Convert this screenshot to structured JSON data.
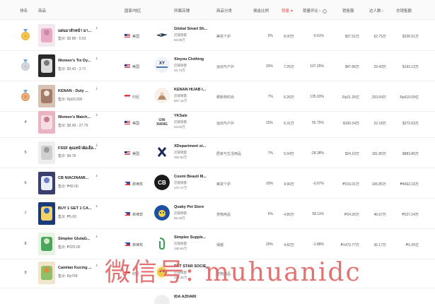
{
  "header": {
    "rank": "排名",
    "product": "商品",
    "region": "国家/地区",
    "shop": "所属店铺",
    "category": "商品分类",
    "commission": "佣金比例",
    "sales": "销量",
    "sales_growth": "销量环比",
    "gmv": "销售额",
    "creators": "达人数",
    "total_gmv": "总销售额"
  },
  "rows": [
    {
      "rank": "1",
      "medal": "gold",
      "name": "แผ่นมาส์กหน้า มา...",
      "price": "售价: $3.88 - 5.53",
      "flag": "us",
      "country": "美国",
      "shop_name": "Global Smart Sh...",
      "shop_sub": "店铺销量:",
      "shop_sales": "83.96万",
      "category": "美妆个护",
      "commission": "5%",
      "sales": "8.00万",
      "growth": "-9.61%",
      "gmv": "$37.51万",
      "creators": "62.75万",
      "total": "$236.51万"
    },
    {
      "rank": "2",
      "medal": "silver",
      "name": "Women's Tie Dy...",
      "price": "售价: $3.43 - 3.71",
      "flag": "us",
      "country": "美国",
      "shop_name": "Xinyou Clothing",
      "shop_sub": "店铺销量:",
      "shop_sales": "40.74万",
      "category": "运动与户外",
      "commission": "20%",
      "sales": "7.25万",
      "growth": "107.25%",
      "gmv": "$47.86万",
      "creators": "29.43万",
      "total": "$193.12万"
    },
    {
      "rank": "3",
      "medal": "bronze",
      "name": "KENAN - Duty ...",
      "price": "售价: Rp50,000",
      "flag": "id",
      "country": "印尼",
      "shop_name": "KENAN HIJAB I...",
      "shop_sub": "店铺销量:",
      "shop_sales": "667.15万",
      "category": "穆斯林时尚",
      "commission": "7%",
      "sales": "6.26万",
      "growth": "135.03%",
      "gmv": "Rp21.26亿",
      "creators": "253.64万",
      "total": "Rp610.09亿"
    },
    {
      "rank": "4",
      "medal": "",
      "name": "Women's Match...",
      "price": "售价: $9.99 - 27.79",
      "flag": "us",
      "country": "美国",
      "shop_name": "YKSale",
      "shop_sub": "店铺销量:",
      "shop_sales": "23.84万",
      "category": "运动与户外",
      "commission": "15%",
      "sales": "5.31万",
      "growth": "55.75%",
      "gmv": "$100.34万",
      "creators": "22.18万",
      "total": "$272.63万"
    },
    {
      "rank": "5",
      "medal": "",
      "name": "FSSF คุณหน้าผ้อเอ็ล...",
      "price": "售价: $4.78",
      "flag": "us",
      "country": "美国",
      "shop_name": "XDepartment st...",
      "shop_sub": "店铺销量:",
      "shop_sales": "352.54万",
      "category": "居家与生活用品",
      "commission": "7%",
      "sales": "5.04万",
      "growth": "-28.38%",
      "gmv": "$24.10万",
      "creators": "181.85万",
      "total": "$883.86万"
    },
    {
      "rank": "6",
      "medal": "",
      "name": "CB NIACINAMI...",
      "price": "售价: ₱49.00",
      "flag": "ph",
      "country": "菲律宾",
      "shop_name": "Cosmi Beauti M...",
      "shop_sub": "店铺销量:",
      "shop_sales": "137.17万",
      "category": "美妆个护",
      "commission": "20%",
      "sales": "4.96万",
      "growth": "-0.07%",
      "gmv": "₱216.01万",
      "creators": "105.85万",
      "total": "₱4662.16万"
    },
    {
      "rank": "7",
      "medal": "",
      "name": "BUY 1 GET 1 CA...",
      "price": "售价: ₱5.00",
      "flag": "ph",
      "country": "菲律宾",
      "shop_name": "Quaky Pet Store",
      "shop_sub": "店铺销量:",
      "shop_sales": "66.28万",
      "category": "宠物用品",
      "commission": "6%",
      "sales": "4.85万",
      "growth": "58.11%",
      "gmv": "₱24.26万",
      "creators": "46.67万",
      "total": "₱227.24万"
    },
    {
      "rank": "8",
      "medal": "",
      "name": "Simplee GlutaG...",
      "price": "售价: ₱325.00",
      "flag": "ph",
      "country": "菲律宾",
      "shop_name": "Simplee Supple...",
      "shop_sub": "店铺销量:",
      "shop_sales": "190.60万",
      "category": "保健",
      "commission": "20%",
      "sales": "4.82万",
      "growth": "-2.88%",
      "gmv": "₱1472.77万",
      "creators": "36.17万",
      "total": "₱1.05亿"
    },
    {
      "rank": "9",
      "medal": "",
      "name": "Camilan Kucing ...",
      "price": "售价: Rp768",
      "flag": "id",
      "country": "印尼",
      "shop_name": "PET STAR SOCIE...",
      "shop_sub": "店铺销量:",
      "shop_sales": "128.35万",
      "category": "宠物用品",
      "commission": "",
      "sales": "",
      "growth": "",
      "gmv": "",
      "creators": "",
      "total": ""
    },
    {
      "rank": "",
      "medal": "",
      "name": "",
      "price": "",
      "flag": "",
      "country": "",
      "shop_name": "IDA AZHARI",
      "shop_sub": "",
      "shop_sales": "",
      "category": "",
      "commission": "",
      "sales": "",
      "growth": "",
      "gmv": "",
      "creators": "",
      "total": ""
    }
  ],
  "watermark": "微信号: muhuanidc",
  "colors": {
    "accent": "#e8584f",
    "gold": "#f2b632",
    "silver": "#c7ccd4",
    "bronze": "#e59a5e"
  }
}
